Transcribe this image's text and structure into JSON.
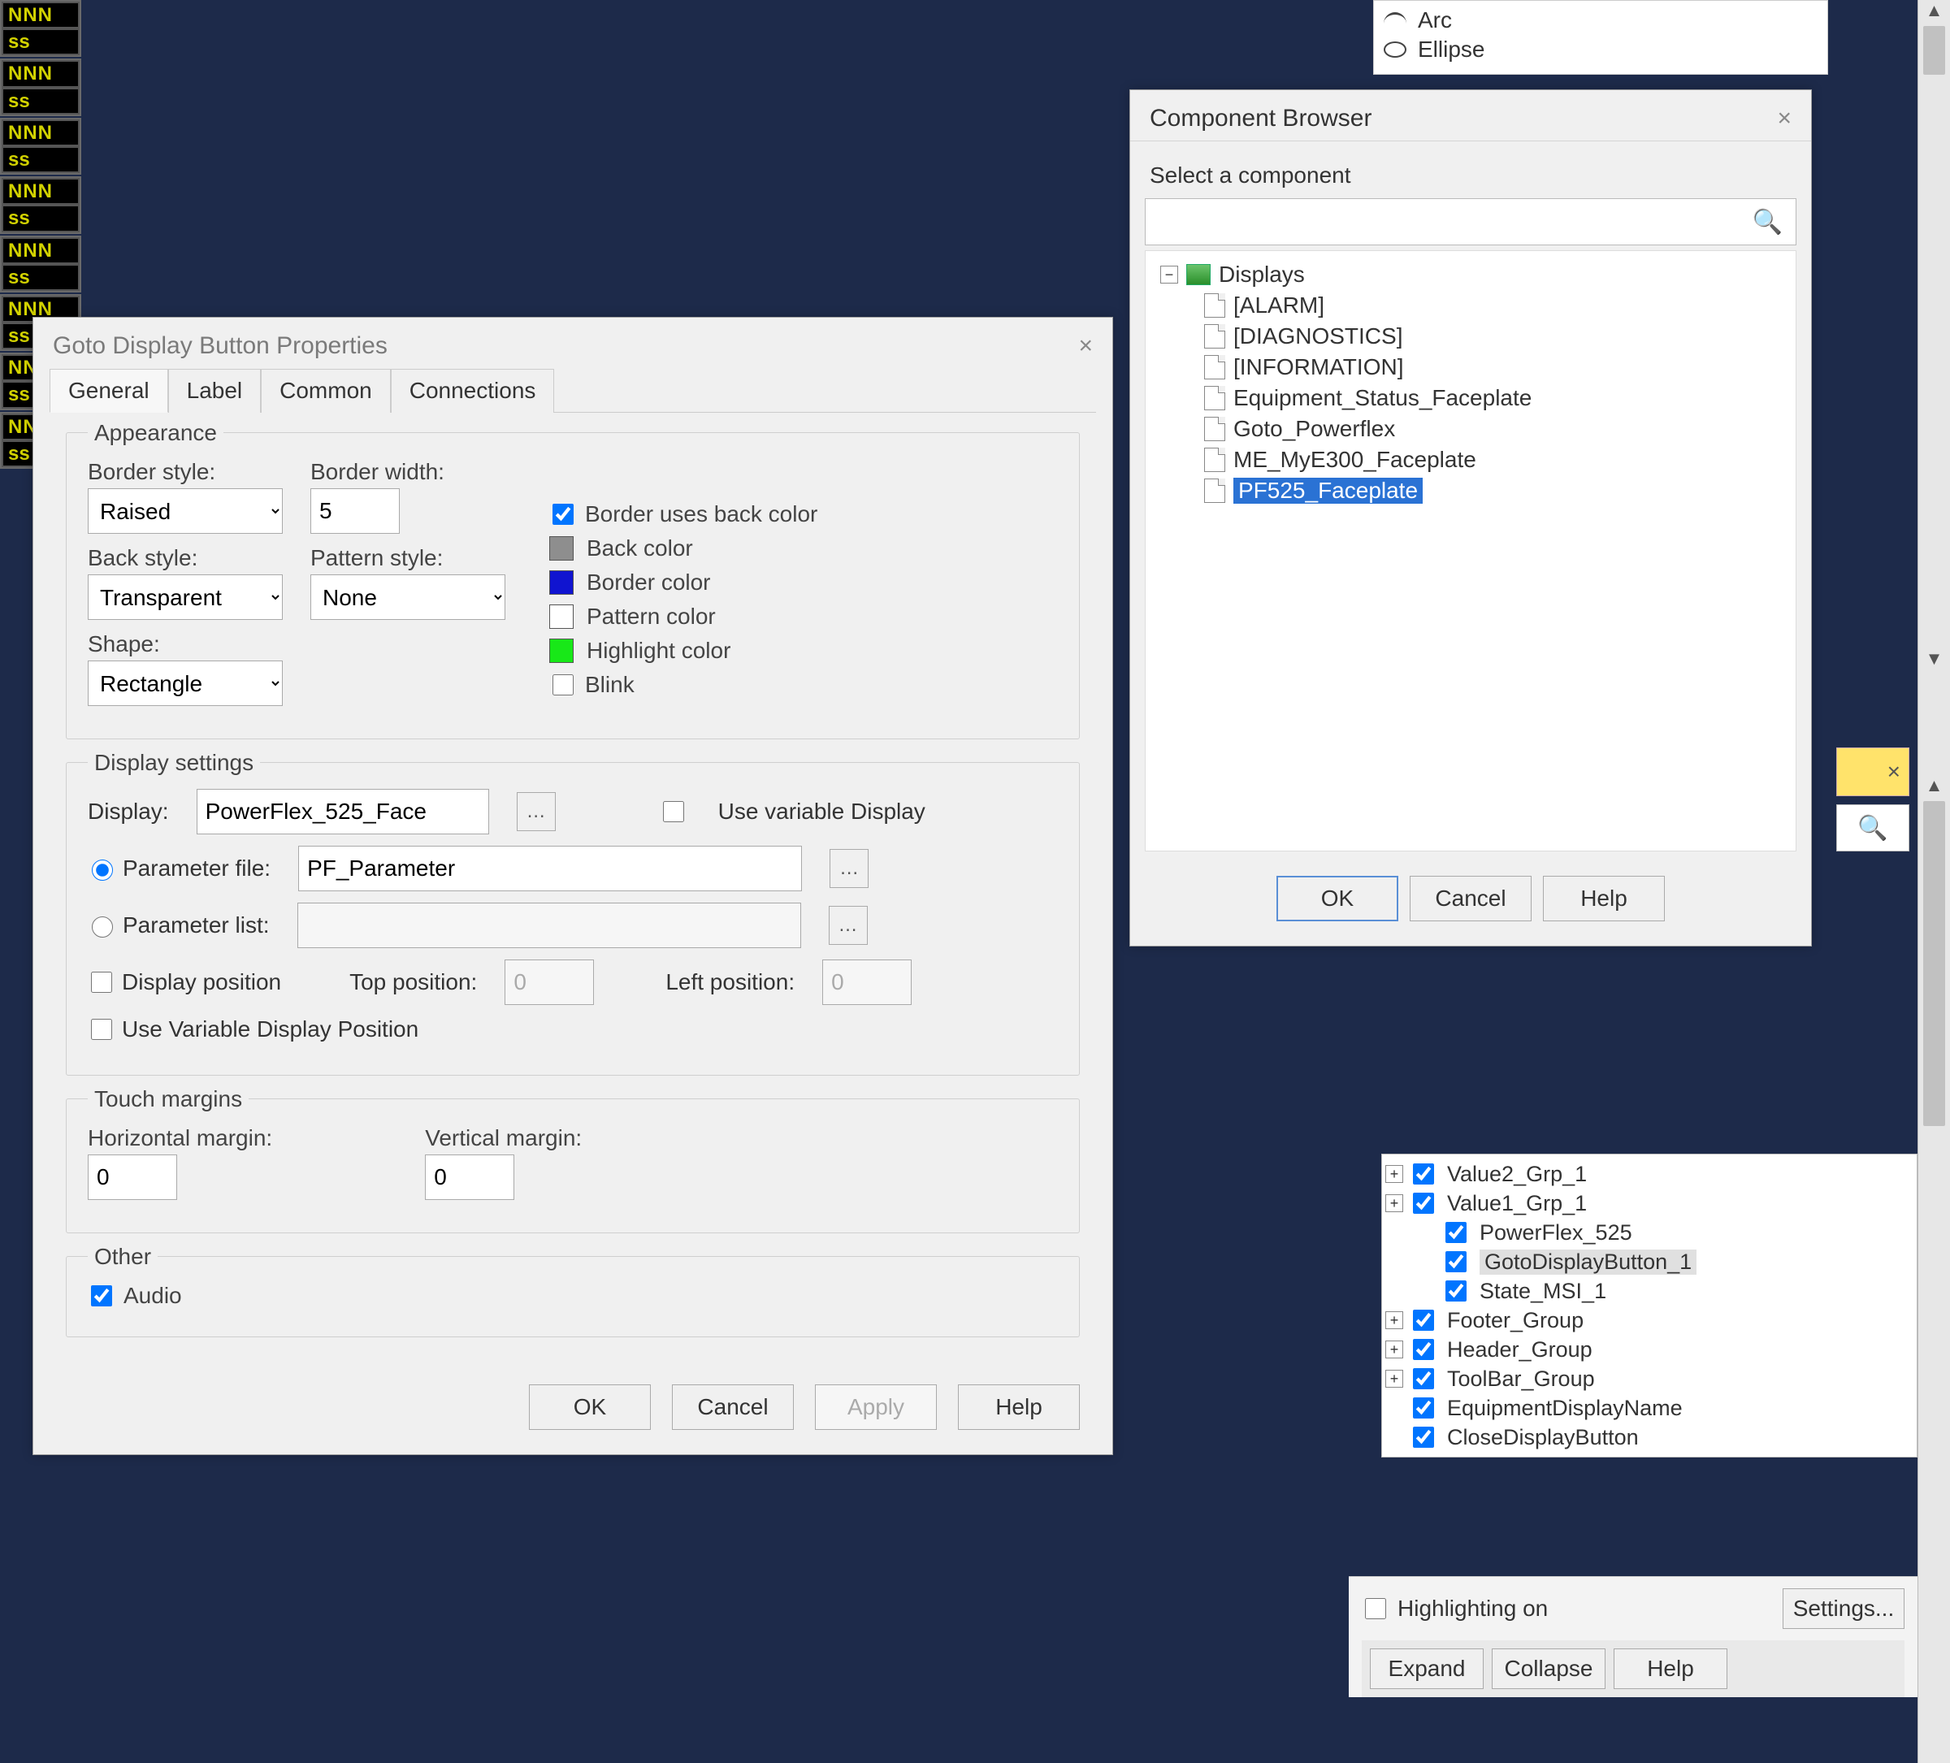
{
  "bg": {
    "big": "NNN",
    "small": "ss"
  },
  "shape_list": [
    {
      "icon": "arc",
      "label": "Arc"
    },
    {
      "icon": "ellipse",
      "label": "Ellipse"
    }
  ],
  "props": {
    "title": "Goto Display Button Properties",
    "tabs": [
      "General",
      "Label",
      "Common",
      "Connections"
    ],
    "active_tab_index": 0,
    "appearance": {
      "legend": "Appearance",
      "labels": {
        "border_style": "Border style:",
        "border_width": "Border width:",
        "back_style": "Back style:",
        "pattern_style": "Pattern style:",
        "shape": "Shape:"
      },
      "values": {
        "border_style": "Raised",
        "border_width": "5",
        "back_style": "Transparent",
        "pattern_style": "None",
        "shape": "Rectangle"
      },
      "checks": {
        "border_uses_back": {
          "label": "Border uses back color",
          "checked": true
        },
        "back_color": {
          "label": "Back color",
          "swatch": "#8e8e8e"
        },
        "border_color": {
          "label": "Border color",
          "swatch": "#1014d0"
        },
        "pattern_color": {
          "label": "Pattern color",
          "swatch": "#ffffff"
        },
        "highlight_color": {
          "label": "Highlight color",
          "swatch": "#18e818"
        },
        "blink": {
          "label": "Blink",
          "checked": false
        }
      }
    },
    "display_settings": {
      "legend": "Display settings",
      "labels": {
        "display": "Display:",
        "parameter_file": "Parameter file:",
        "parameter_list": "Parameter list:",
        "use_var_display": "Use variable Display",
        "display_position": "Display position",
        "top_position": "Top position:",
        "left_position": "Left position:",
        "use_var_pos": "Use Variable Display Position"
      },
      "values": {
        "display": "PowerFlex_525_Face",
        "parameter_file": "PF_Parameter",
        "parameter_list": "",
        "top_pos": "0",
        "left_pos": "0"
      },
      "radio_selected": "file",
      "use_var_display": false,
      "display_position": false,
      "use_var_pos": false
    },
    "touch": {
      "legend": "Touch margins",
      "hlabel": "Horizontal  margin:",
      "vlabel": "Vertical margin:",
      "hval": "0",
      "vval": "0"
    },
    "other": {
      "legend": "Other",
      "audio_label": "Audio",
      "audio": true
    },
    "buttons": {
      "ok": "OK",
      "cancel": "Cancel",
      "apply": "Apply",
      "help": "Help"
    }
  },
  "browser": {
    "title": "Component Browser",
    "prompt": "Select a component",
    "root": "Displays",
    "items": [
      "[ALARM]",
      "[DIAGNOSTICS]",
      "[INFORMATION]",
      "Equipment_Status_Faceplate",
      "Goto_Powerflex",
      "ME_MyE300_Faceplate",
      "PF525_Faceplate"
    ],
    "selected_index": 6,
    "buttons": {
      "ok": "OK",
      "cancel": "Cancel",
      "help": "Help"
    }
  },
  "explorer": {
    "items_top": [
      "Value2_Grp_1",
      "Value1_Grp_1"
    ],
    "items_inner": [
      "PowerFlex_525",
      "GotoDisplayButton_1",
      "State_MSI_1"
    ],
    "selected_inner_index": 1,
    "items_bottom": [
      "Footer_Group",
      "Header_Group",
      "ToolBar_Group",
      "EquipmentDisplayName",
      "CloseDisplayButton"
    ],
    "hl_label": "Highlighting on",
    "hl_checked": false,
    "settings_btn": "Settings...",
    "expand_btn": "Expand",
    "collapse_btn": "Collapse",
    "help_btn": "Help"
  }
}
